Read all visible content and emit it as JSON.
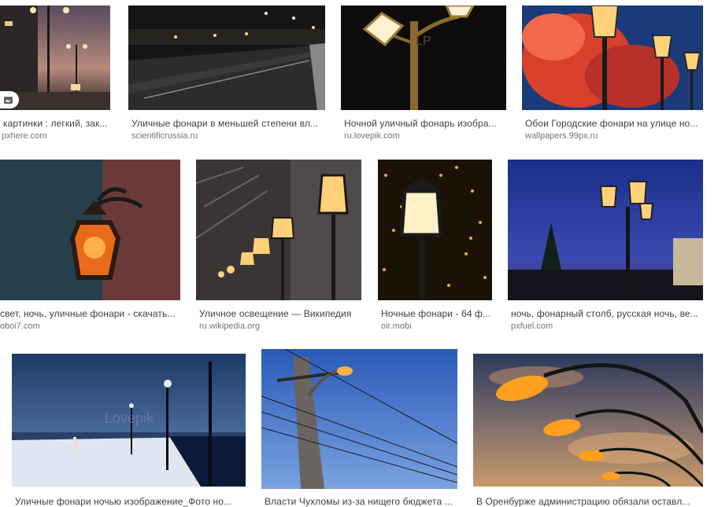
{
  "results": [
    {
      "title": "картинки : легкий, зак...",
      "source": "pxhere.com"
    },
    {
      "title": "Уличные фонари в меньшей степени вл...",
      "source": "scientificrussia.ru"
    },
    {
      "title": "Ночной уличный фонарь изобра...",
      "source": "ru.lovepik.com"
    },
    {
      "title": "Обои Городские фонари на улице но...",
      "source": "wallpapers.99px.ru"
    },
    {
      "title": "свет, ночь, уличные фонари - скачать...",
      "source": "oboi7.com"
    },
    {
      "title": "Уличное освещение — Википедия",
      "source": "ru.wikipedia.org"
    },
    {
      "title": "Ночные фонари - 64 ф...",
      "source": "oir.mobi"
    },
    {
      "title": "ночь, фонарный столб, русская ночь, ве...",
      "source": "pxfuel.com"
    },
    {
      "title": "Уличные фонари ночью изображение_Фото но...",
      "source": ""
    },
    {
      "title": "Власти Чухломы из-за нищего бюджета ...",
      "source": ""
    },
    {
      "title": "В Оренбурже администрацию обязали оставл...",
      "source": ""
    }
  ],
  "watermark_text": "Lovepik",
  "colors": {
    "caption": "#3c4043",
    "source": "#70757a"
  }
}
